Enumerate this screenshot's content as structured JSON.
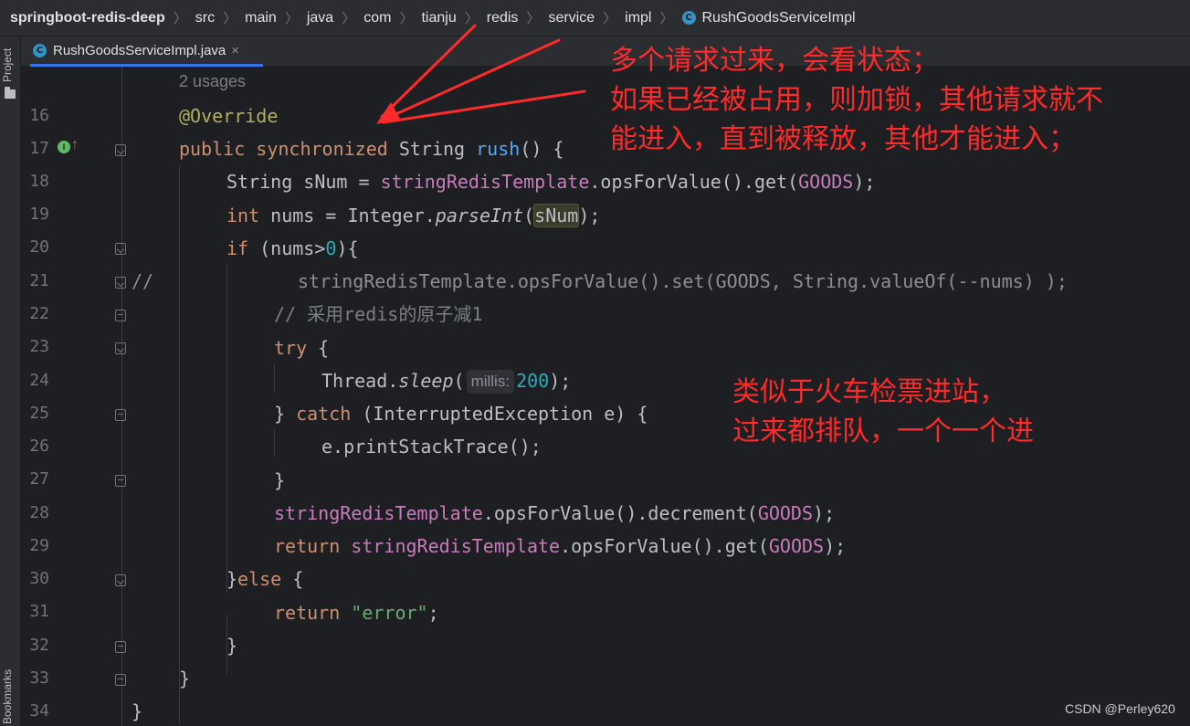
{
  "breadcrumb": {
    "project": "springboot-redis-deep",
    "parts": [
      "src",
      "main",
      "java",
      "com",
      "tianju",
      "redis",
      "service",
      "impl"
    ],
    "class_name": "RushGoodsServiceImpl",
    "class_icon_letter": "C"
  },
  "toolstrip": {
    "project_label": "Project",
    "bookmarks_label": "Bookmarks"
  },
  "tab": {
    "icon_letter": "C",
    "label": "RushGoodsServiceImpl.java",
    "close_glyph": "×"
  },
  "editor": {
    "usages_hint": "2 usages",
    "implements_icon_letter": "I",
    "implements_arrow": "↑",
    "param_hint": "millis:",
    "line_numbers": [
      "16",
      "17",
      "18",
      "19",
      "20",
      "21",
      "22",
      "23",
      "24",
      "25",
      "26",
      "27",
      "28",
      "29",
      "30",
      "31",
      "32",
      "33",
      "34"
    ],
    "code": {
      "l16": "@Override",
      "l17_kw1": "public",
      "l17_kw2": "synchronized",
      "l17_type": "String",
      "l17_fn": "rush",
      "l17_rest": "() {",
      "l18_a": "String sNum = ",
      "l18_field": "stringRedisTemplate",
      "l18_b": ".opsForValue().get(",
      "l18_const": "GOODS",
      "l18_c": ");",
      "l19_kw": "int",
      "l19_a": " nums = Integer.",
      "l19_m": "parseInt",
      "l19_b": "(",
      "l19_var": "sNum",
      "l19_c": ");",
      "l20_kw": "if",
      "l20_a": " (nums>",
      "l20_num": "0",
      "l20_b": "){",
      "l21_slashes": "//",
      "l21_text": "stringRedisTemplate.opsForValue().set(GOODS, String.valueOf(--nums) );",
      "l22": "// 采用redis的原子减1",
      "l23_kw": "try",
      "l23_b": " {",
      "l24_a": "Thread.",
      "l24_m": "sleep",
      "l24_b": "(",
      "l24_num": "200",
      "l24_c": ");",
      "l25_a": "} ",
      "l25_kw": "catch",
      "l25_b": " (InterruptedException e) {",
      "l26": "e.printStackTrace();",
      "l27": "}",
      "l28_field": "stringRedisTemplate",
      "l28_a": ".opsForValue().decrement(",
      "l28_const": "GOODS",
      "l28_b": ");",
      "l29_kw": "return",
      "l29_field": "stringRedisTemplate",
      "l29_a": ".opsForValue().get(",
      "l29_const": "GOODS",
      "l29_b": ");",
      "l30_a": "}",
      "l30_kw": "else",
      "l30_b": " {",
      "l31_kw": "return",
      "l31_str": "\"error\"",
      "l31_b": ";",
      "l32": "}",
      "l33": "}",
      "l34": "}"
    }
  },
  "annotations": {
    "top_lines": [
      "多个请求过来，会看状态；",
      "如果已经被占用，则加锁，其他请求就不",
      "能进入，直到被释放，其他才能进入；"
    ],
    "middle_lines": [
      "类似于火车检票进站，",
      "过来都排队，一个一个进"
    ],
    "color": "#ff2a2a"
  },
  "watermark": "CSDN @Perley620",
  "colors": {
    "background": "#1e1f22",
    "panel": "#2b2d30",
    "keyword": "#cf8e6d",
    "annotation_kw": "#b3ae60",
    "method": "#56a8f5",
    "field": "#c77dbb",
    "number": "#2aacb8",
    "string": "#6aab73",
    "comment": "#7a7e85"
  }
}
